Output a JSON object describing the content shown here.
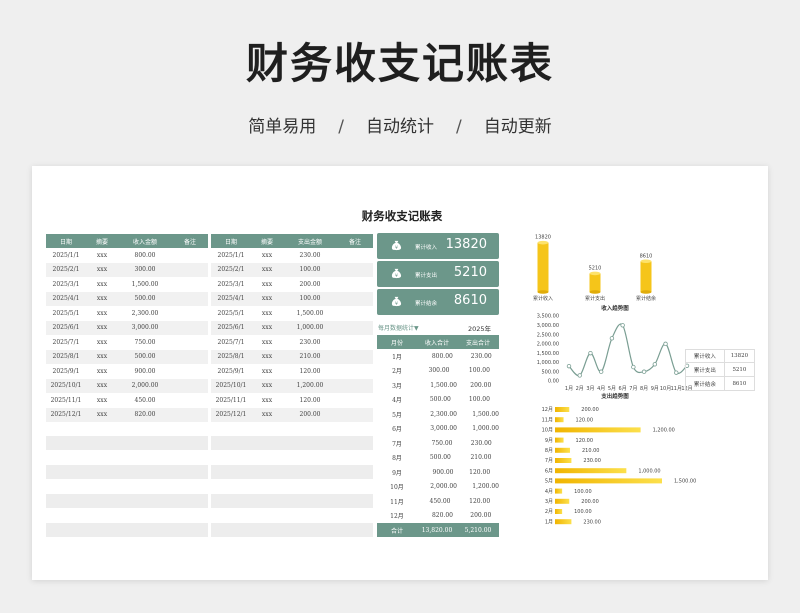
{
  "header": {
    "title": "财务收支记账表",
    "tagline": [
      "简单易用",
      "自动统计",
      "自动更新"
    ],
    "separator": "/"
  },
  "sheet": {
    "title": "财务收支记账表",
    "income_table": {
      "headers": [
        "日期",
        "摘要",
        "收入金额",
        "备注"
      ],
      "rows": [
        [
          "2025/1/1",
          "xxx",
          "800.00",
          ""
        ],
        [
          "2025/2/1",
          "xxx",
          "300.00",
          ""
        ],
        [
          "2025/3/1",
          "xxx",
          "1,500.00",
          ""
        ],
        [
          "2025/4/1",
          "xxx",
          "500.00",
          ""
        ],
        [
          "2025/5/1",
          "xxx",
          "2,300.00",
          ""
        ],
        [
          "2025/6/1",
          "xxx",
          "3,000.00",
          ""
        ],
        [
          "2025/7/1",
          "xxx",
          "750.00",
          ""
        ],
        [
          "2025/8/1",
          "xxx",
          "500.00",
          ""
        ],
        [
          "2025/9/1",
          "xxx",
          "900.00",
          ""
        ],
        [
          "2025/10/1",
          "xxx",
          "2,000.00",
          ""
        ],
        [
          "2025/11/1",
          "xxx",
          "450.00",
          ""
        ],
        [
          "2025/12/1",
          "xxx",
          "820.00",
          ""
        ]
      ]
    },
    "expense_table": {
      "headers": [
        "日期",
        "摘要",
        "支出金额",
        "备注"
      ],
      "rows": [
        [
          "2025/1/1",
          "xxx",
          "230.00",
          ""
        ],
        [
          "2025/2/1",
          "xxx",
          "100.00",
          ""
        ],
        [
          "2025/3/1",
          "xxx",
          "200.00",
          ""
        ],
        [
          "2025/4/1",
          "xxx",
          "100.00",
          ""
        ],
        [
          "2025/5/1",
          "xxx",
          "1,500.00",
          ""
        ],
        [
          "2025/6/1",
          "xxx",
          "1,000.00",
          ""
        ],
        [
          "2025/7/1",
          "xxx",
          "230.00",
          ""
        ],
        [
          "2025/8/1",
          "xxx",
          "210.00",
          ""
        ],
        [
          "2025/9/1",
          "xxx",
          "120.00",
          ""
        ],
        [
          "2025/10/1",
          "xxx",
          "1,200.00",
          ""
        ],
        [
          "2025/11/1",
          "xxx",
          "120.00",
          ""
        ],
        [
          "2025/12/1",
          "xxx",
          "200.00",
          ""
        ]
      ]
    },
    "cards": [
      {
        "label": "累计收入",
        "value": "13820",
        "icon": "money-bag-icon"
      },
      {
        "label": "累计支出",
        "value": "5210",
        "icon": "money-bag-icon"
      },
      {
        "label": "累计结余",
        "value": "8610",
        "icon": "money-bag-icon"
      }
    ],
    "monthly": {
      "label": "每月数据统计",
      "dropdown_icon": "chevron-down-icon",
      "year": "2025年",
      "headers": [
        "月份",
        "收入合计",
        "支出合计"
      ],
      "rows": [
        {
          "month": "1月",
          "income": "800.00",
          "expense": "230.00",
          "in_v": 800,
          "out_v": 230
        },
        {
          "month": "2月",
          "income": "300.00",
          "expense": "100.00",
          "in_v": 300,
          "out_v": 100
        },
        {
          "month": "3月",
          "income": "1,500.00",
          "expense": "200.00",
          "in_v": 1500,
          "out_v": 200
        },
        {
          "month": "4月",
          "income": "500.00",
          "expense": "100.00",
          "in_v": 500,
          "out_v": 100
        },
        {
          "month": "5月",
          "income": "2,300.00",
          "expense": "1,500.00",
          "in_v": 2300,
          "out_v": 1500
        },
        {
          "month": "6月",
          "income": "3,000.00",
          "expense": "1,000.00",
          "in_v": 3000,
          "out_v": 1000
        },
        {
          "month": "7月",
          "income": "750.00",
          "expense": "230.00",
          "in_v": 750,
          "out_v": 230
        },
        {
          "month": "8月",
          "income": "500.00",
          "expense": "210.00",
          "in_v": 500,
          "out_v": 210
        },
        {
          "month": "9月",
          "income": "900.00",
          "expense": "120.00",
          "in_v": 900,
          "out_v": 120
        },
        {
          "month": "10月",
          "income": "2,000.00",
          "expense": "1,200.00",
          "in_v": 2000,
          "out_v": 1200
        },
        {
          "month": "11月",
          "income": "450.00",
          "expense": "120.00",
          "in_v": 450,
          "out_v": 120
        },
        {
          "month": "12月",
          "income": "820.00",
          "expense": "200.00",
          "in_v": 820,
          "out_v": 200
        }
      ],
      "total": {
        "label": "合计",
        "income": "13,820.00",
        "expense": "5,210.00"
      }
    },
    "summary_side": [
      {
        "label": "累计收入",
        "value": "13820"
      },
      {
        "label": "累计支出",
        "value": "5210"
      },
      {
        "label": "累计结余",
        "value": "8610"
      }
    ],
    "colors": {
      "accent": "#6c978a",
      "gold": "#f5c51a",
      "line": "#7a9e93"
    }
  },
  "chart_data": [
    {
      "type": "bar",
      "title": "",
      "categories": [
        "累计收入",
        "累计支出",
        "累计结余"
      ],
      "values": [
        13820,
        5210,
        8610
      ],
      "data_labels": [
        "13820",
        "5210",
        "8610"
      ],
      "ylim": [
        0,
        14000
      ]
    },
    {
      "type": "line",
      "title": "收入趋势图",
      "categories": [
        "1月",
        "2月",
        "3月",
        "4月",
        "5月",
        "6月",
        "7月",
        "8月",
        "9月",
        "10月",
        "11月",
        "12月"
      ],
      "values": [
        800,
        300,
        1500,
        500,
        2300,
        3000,
        750,
        500,
        900,
        2000,
        450,
        820
      ],
      "yticks": [
        "3,500.00",
        "3,000.00",
        "2,500.00",
        "2,000.00",
        "1,500.00",
        "1,000.00",
        "500.00",
        "0.00"
      ],
      "ylim": [
        0,
        3500
      ]
    },
    {
      "type": "bar",
      "orientation": "horizontal",
      "title": "支出趋势图",
      "categories": [
        "12月",
        "11月",
        "10月",
        "9月",
        "8月",
        "7月",
        "6月",
        "5月",
        "4月",
        "3月",
        "2月",
        "1月"
      ],
      "values": [
        200,
        120,
        1200,
        120,
        210,
        230,
        1000,
        1500,
        100,
        200,
        100,
        230
      ],
      "data_labels": [
        "200.00",
        "120.00",
        "1,200.00",
        "120.00",
        "210.00",
        "230.00",
        "1,000.00",
        "1,500.00",
        "100.00",
        "200.00",
        "100.00",
        "230.00"
      ],
      "xlim": [
        0,
        1500
      ]
    }
  ]
}
